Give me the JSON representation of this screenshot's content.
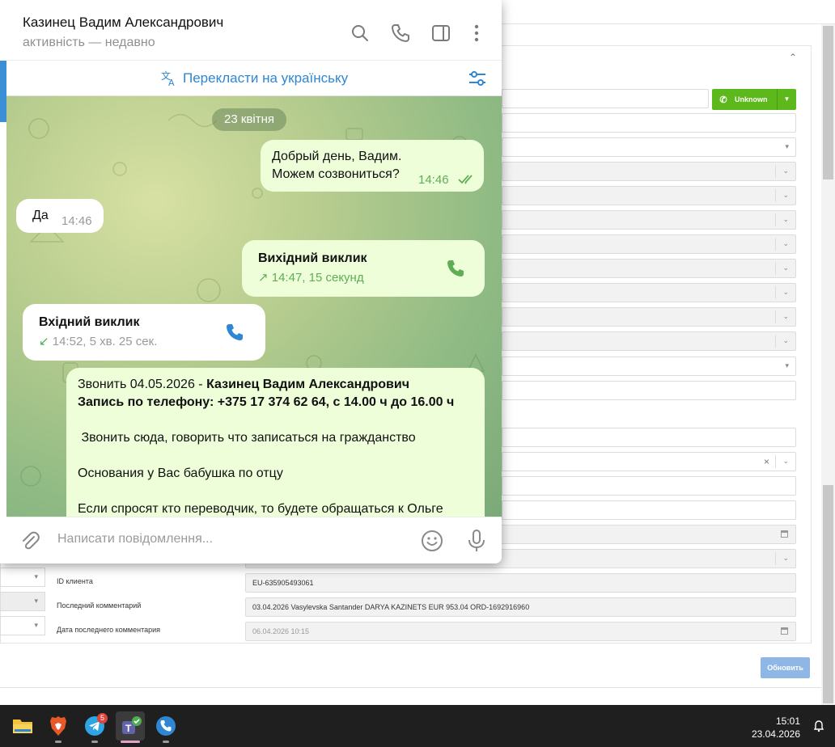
{
  "telegram": {
    "contact_name": "Казинец Вадим Александрович",
    "contact_status": "активність — недавно",
    "translate_label": "Перекласти на українську",
    "input_placeholder": "Написати повідомлення...",
    "date_divider": "23 квітня",
    "messages": [
      {
        "direction": "out",
        "lines": [
          "Добрый день, Вадим.",
          "Можем созвониться?"
        ],
        "time": "14:46",
        "read": true
      },
      {
        "direction": "in",
        "lines": [
          "Да"
        ],
        "time": "14:46"
      },
      {
        "direction": "out",
        "type": "call",
        "title": "Вихідний виклик",
        "detail": "14:47, 15 секунд",
        "arrow": "↗"
      },
      {
        "direction": "in",
        "type": "call",
        "title": "Вхідний виклик",
        "detail": "14:52, 5 хв. 25 сек.",
        "arrow": "↙"
      },
      {
        "direction": "out",
        "type": "long",
        "line1_prefix": "Звонить 04.05.2026 - ",
        "line1_bold": "Казинец Вадим Александрович",
        "line2_bold": "Запись по телефону: +375 17 374 62 64, с 14.00 ч до 16.00 ч",
        "para1": " Звонить сюда, говорить что записаться на гражданство",
        "para2": "Основания у Вас бабушка по отцу",
        "para3": "Если спросят кто переводчик, то будете обращаться к Ольге"
      }
    ]
  },
  "crm": {
    "phone_button_label": "Unknown",
    "refresh_label": "Обновить",
    "fields": [
      {
        "label": "ID клиента",
        "value": "EU-635905493061"
      },
      {
        "label": "Последний комментарий",
        "value": "03.04.2026 Vasylevska Santander  DARYA KAZINETS EUR 953.04 ORD-1692916960"
      },
      {
        "label": "Дата последнего комментария",
        "value": "06.04.2026 10:15"
      }
    ]
  },
  "taskbar": {
    "apps": [
      "file-explorer",
      "brave-browser",
      "telegram",
      "teams",
      "phone-app"
    ],
    "telegram_badge": "5",
    "time": "15:01",
    "date": "23.04.2026"
  },
  "colors": {
    "telegram_blue": "#2f86d2",
    "outgoing_bubble": "#eefed9",
    "time_green": "#5fae55",
    "crm_green_button": "#5cb81b",
    "crm_refresh_button": "#8fb7e6"
  }
}
